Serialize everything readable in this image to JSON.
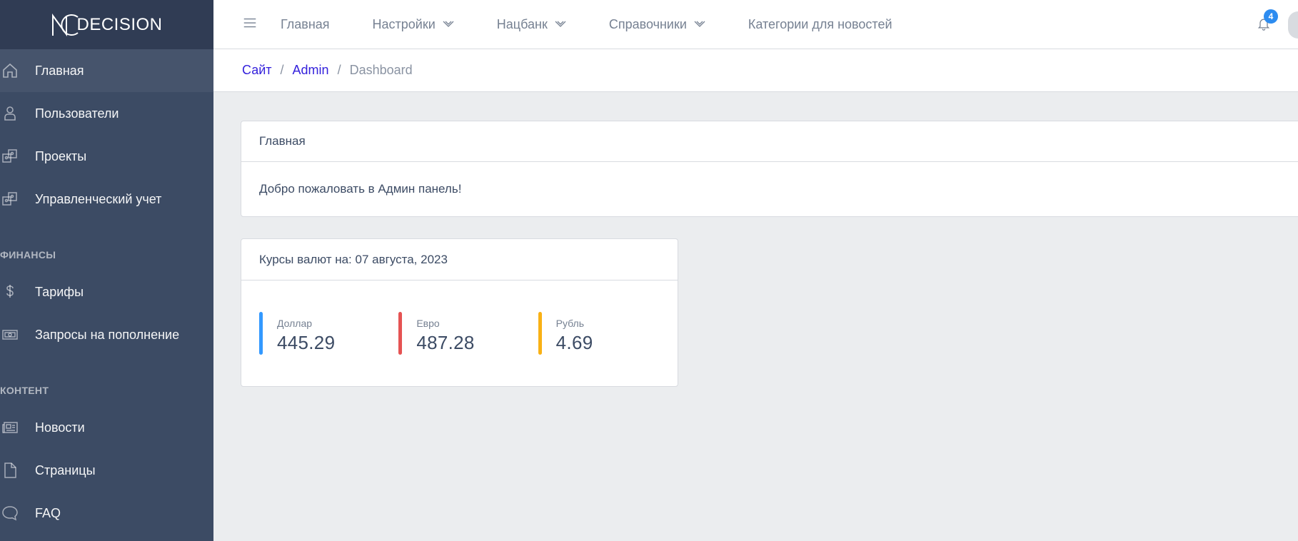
{
  "brand": {
    "name": "DECISION"
  },
  "sidebar": {
    "items": [
      {
        "label": "Главная",
        "icon": "home-icon",
        "active": true
      },
      {
        "label": "Пользователи",
        "icon": "user-icon"
      },
      {
        "label": "Проекты",
        "icon": "puzzle-icon"
      },
      {
        "label": "Управленческий учет",
        "icon": "puzzle-icon"
      }
    ],
    "sections": [
      {
        "title": "Финансы",
        "items": [
          {
            "label": "Тарифы",
            "icon": "dollar-icon"
          },
          {
            "label": "Запросы на пополнение",
            "icon": "money-icon"
          }
        ]
      },
      {
        "title": "Контент",
        "items": [
          {
            "label": "Новости",
            "icon": "newspaper-icon"
          },
          {
            "label": "Страницы",
            "icon": "file-icon"
          },
          {
            "label": "FAQ",
            "icon": "speech-icon"
          }
        ]
      }
    ]
  },
  "header": {
    "nav": [
      {
        "label": "Главная",
        "dropdown": false
      },
      {
        "label": "Настройки",
        "dropdown": true
      },
      {
        "label": "Нацбанк",
        "dropdown": true
      },
      {
        "label": "Справочники",
        "dropdown": true
      },
      {
        "label": "Категории для новостей",
        "dropdown": false
      }
    ],
    "notifications_count": "4"
  },
  "breadcrumb": {
    "items": [
      "Сайт",
      "Admin"
    ],
    "current": "Dashboard"
  },
  "main_card": {
    "title": "Главная",
    "body": "Добро пожаловать в Админ панель!"
  },
  "rates_card": {
    "title": "Курсы валют на: 07 августа, 2023",
    "rates": [
      {
        "label": "Доллар",
        "value": "445.29",
        "color": "#3399ff"
      },
      {
        "label": "Евро",
        "value": "487.28",
        "color": "#e55353"
      },
      {
        "label": "Рубль",
        "value": "4.69",
        "color": "#f9b115"
      }
    ]
  },
  "colors": {
    "sidebar_bg": "#3c4b64",
    "brand_bg": "#303c54",
    "link": "#321fdb",
    "badge": "#2d8cf0"
  }
}
